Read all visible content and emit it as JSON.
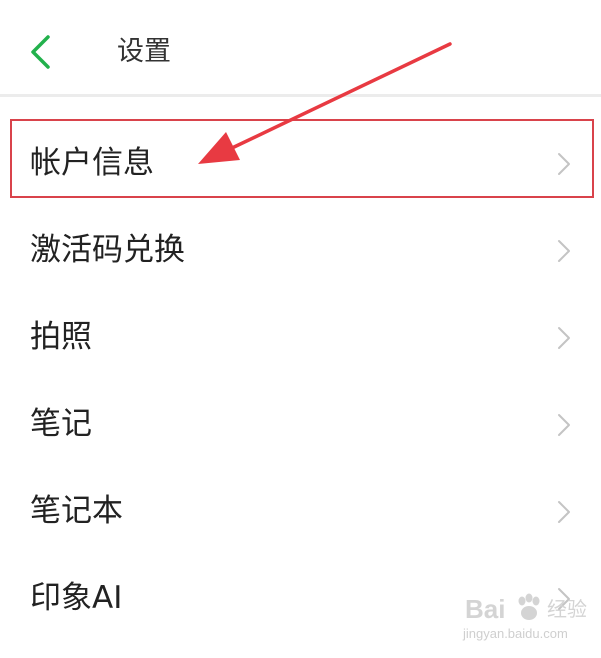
{
  "header": {
    "title": "设置",
    "back_icon": "chevron-left-icon",
    "accent_color": "#22b14c"
  },
  "settings": {
    "items": [
      {
        "label": "帐户信息",
        "highlighted": true
      },
      {
        "label": "激活码兑换"
      },
      {
        "label": "拍照"
      },
      {
        "label": "笔记"
      },
      {
        "label": "笔记本"
      },
      {
        "label": "印象AI"
      }
    ],
    "chevron_icon": "chevron-right-icon"
  },
  "annotation": {
    "highlight_color": "#d9434b",
    "arrow_icon": "red-arrow-icon"
  },
  "watermark": {
    "brand_a": "Bai",
    "brand_b": "经验",
    "url": "jingyan.baidu.com"
  }
}
